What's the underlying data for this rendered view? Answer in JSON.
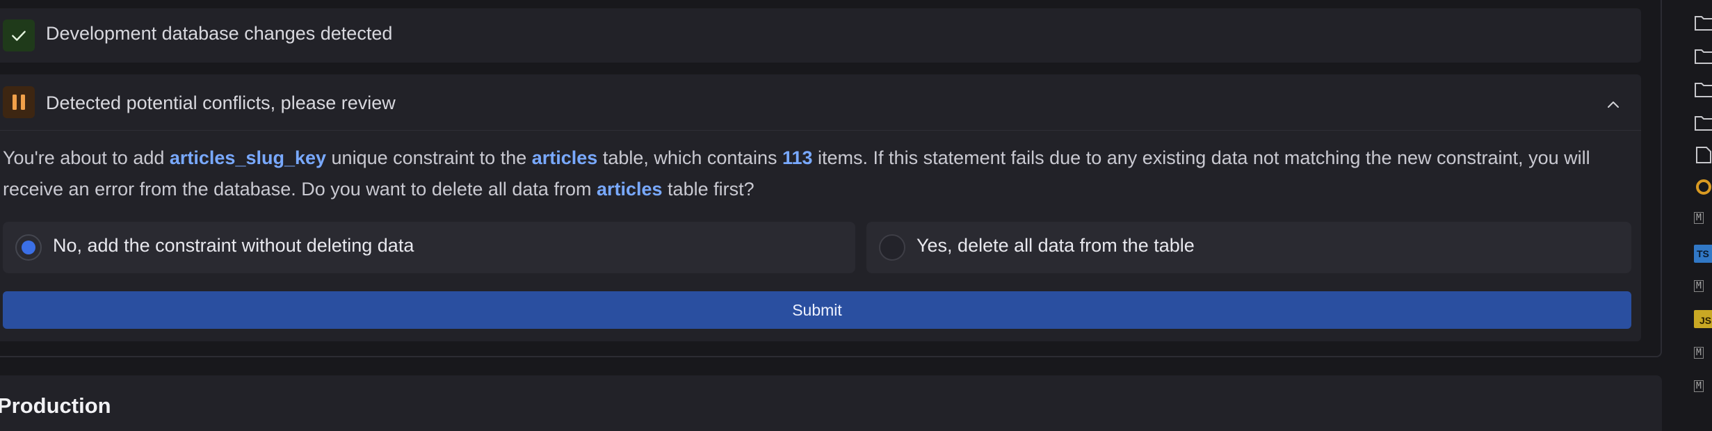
{
  "status_row": {
    "title": "Development database changes detected"
  },
  "conflict": {
    "title": "Detected potential conflicts, please review",
    "description": {
      "p1": "You're about to add ",
      "constraint_name": "articles_slug_key",
      "p2": " unique constraint to the ",
      "table_name": "articles",
      "p3": " table, which contains ",
      "item_count": "113",
      "p4": " items. If this statement fails due to any existing data not matching the new constraint, you will receive an error from the database. Do you want to delete all data from ",
      "table_name_2": "articles",
      "p5": " table first?"
    },
    "options": [
      {
        "label": "No, add the constraint without deleting data",
        "selected": true
      },
      {
        "label": "Yes, delete all data from the table",
        "selected": false
      }
    ],
    "submit_label": "Submit"
  },
  "production": {
    "title": "Production"
  },
  "sidebar": {
    "icons": [
      "folder-icon",
      "folder-icon",
      "folder-icon",
      "folder-icon",
      "file-icon",
      "ring-icon",
      "markdown-icon",
      "typescript-icon",
      "markdown-icon",
      "javascript-icon",
      "markdown-icon",
      "markdown-icon"
    ],
    "ts_badge": "TS",
    "js_badge": "JS",
    "md_badge": "M"
  },
  "colors": {
    "background": "#18181c",
    "card": "#222228",
    "accent": "#3b6fe6",
    "submit": "#2a4fa0",
    "highlight": "#79a9ff",
    "success": "#1f3a1a",
    "warning": "#3d2612"
  }
}
